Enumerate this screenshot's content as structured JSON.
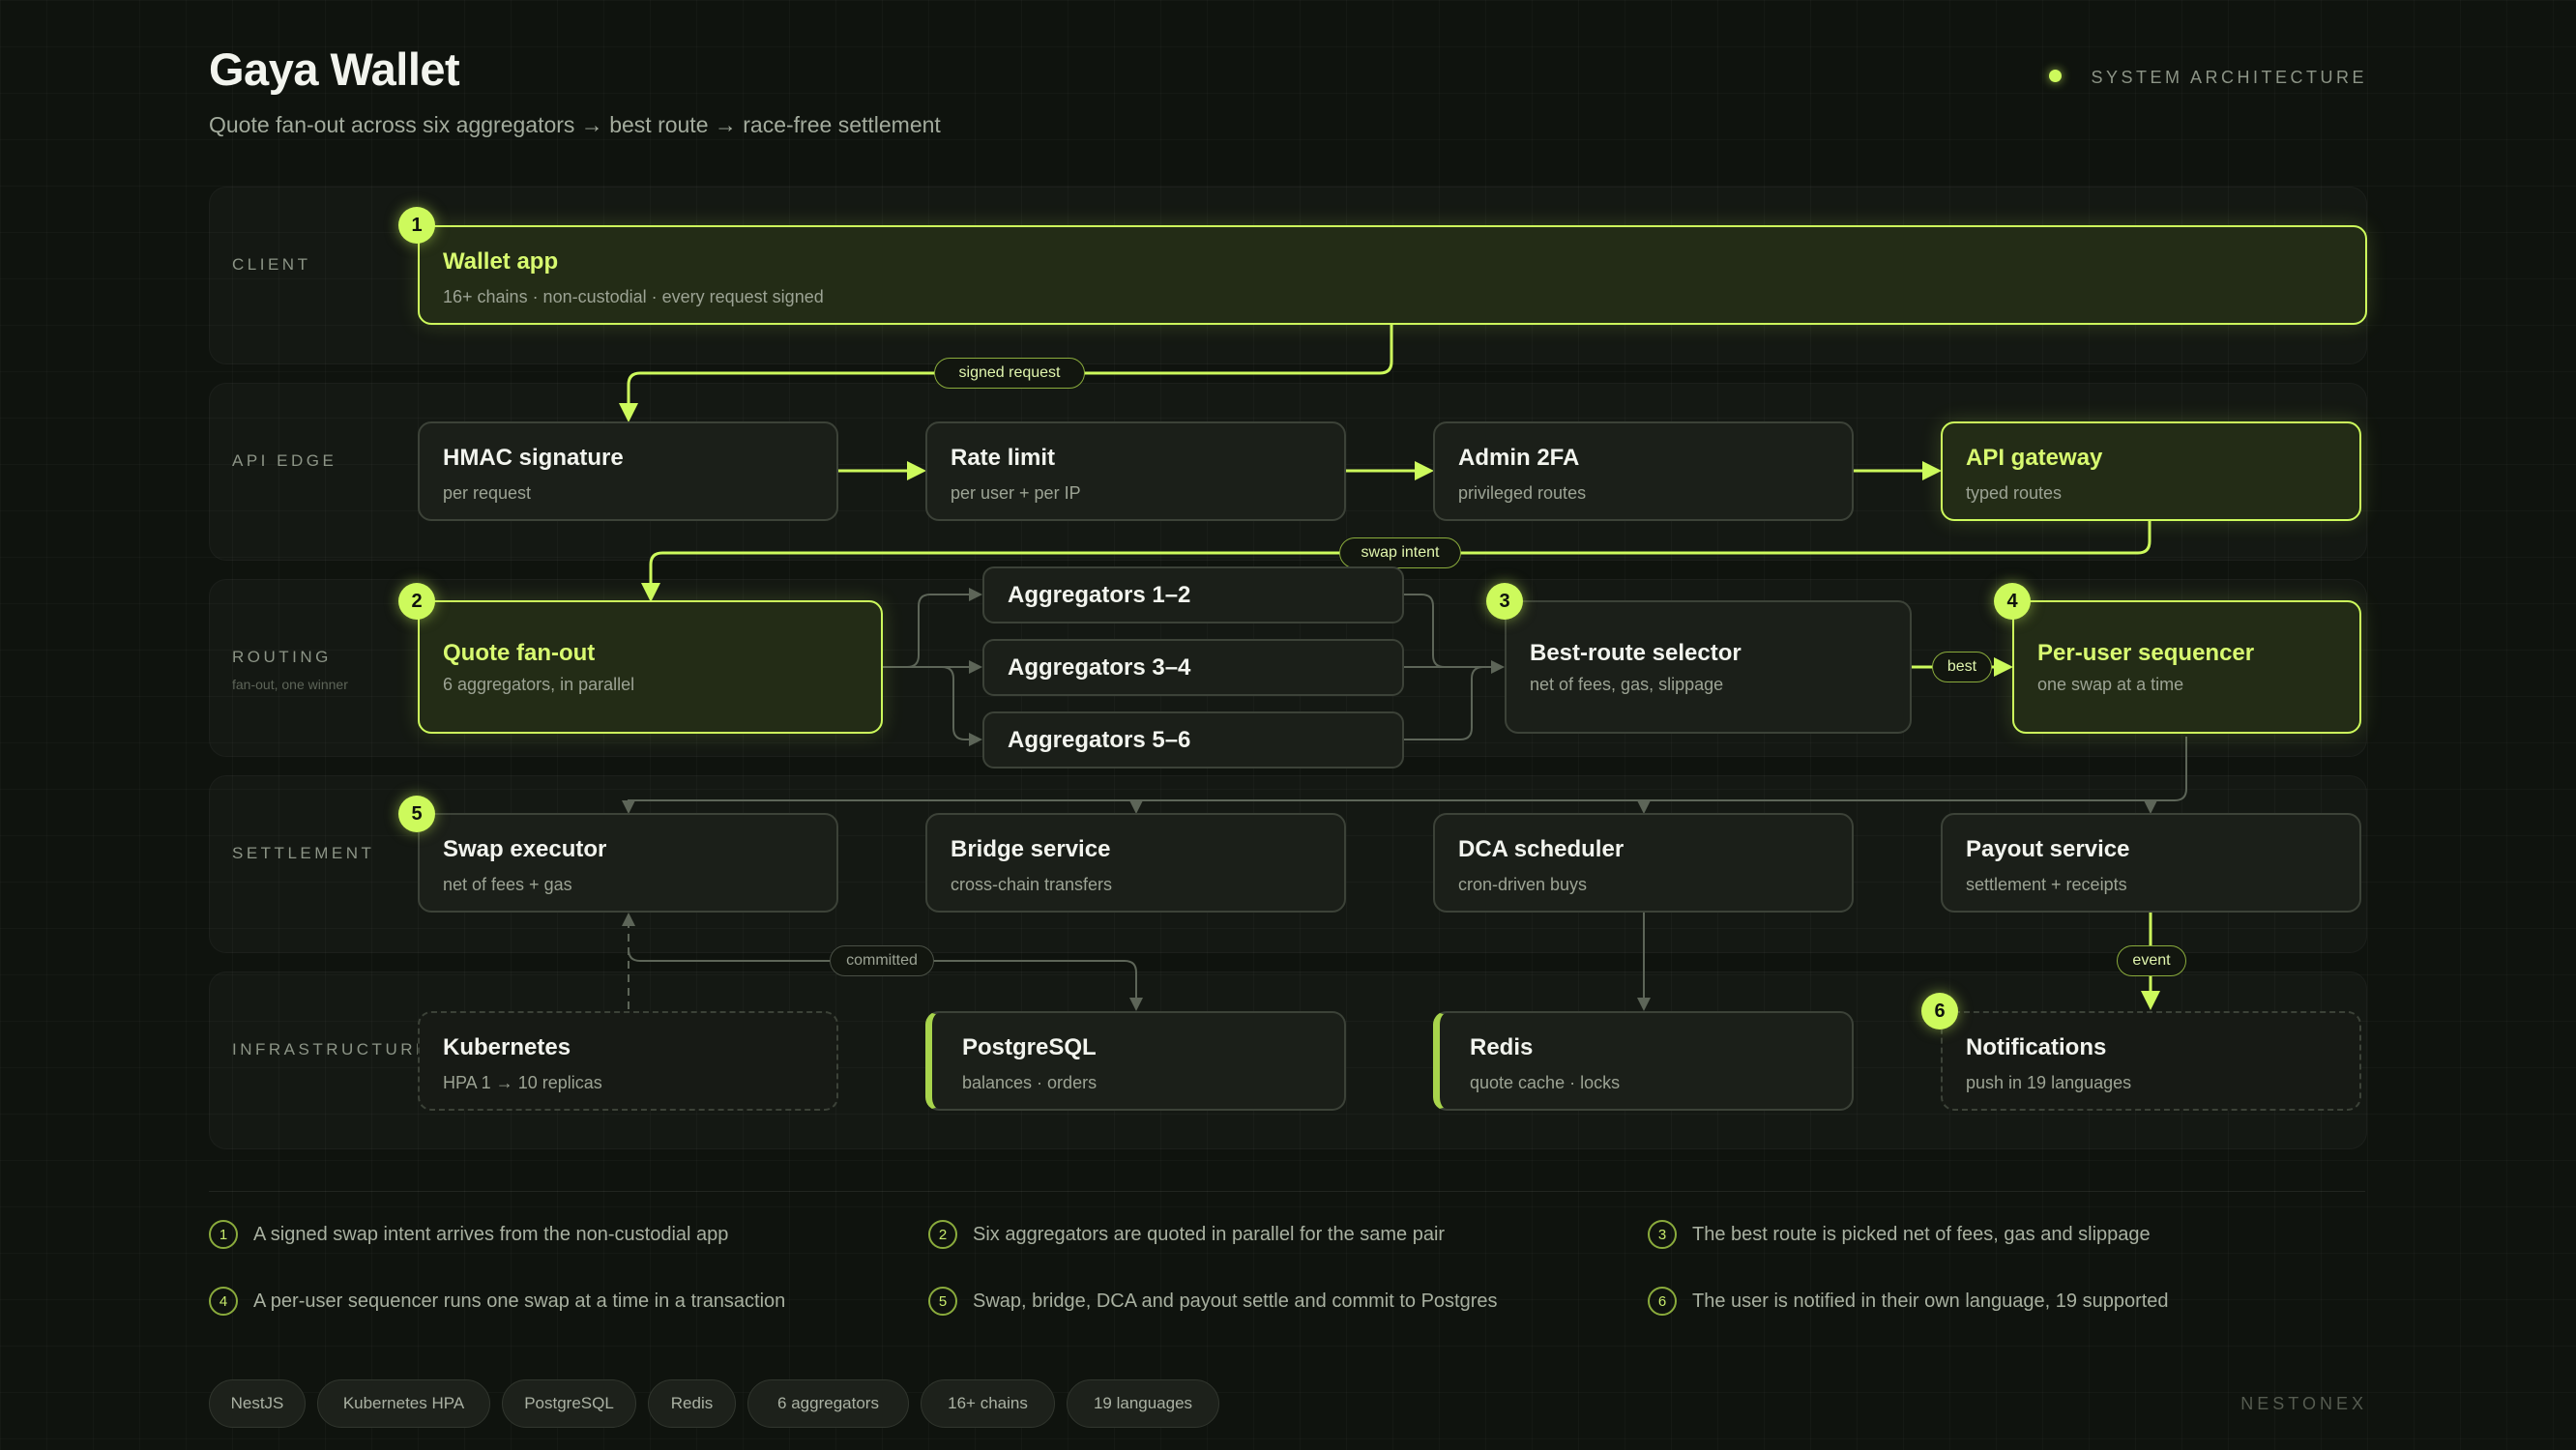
{
  "header": {
    "title": "Gaya Wallet",
    "subtitle": "Quote fan-out across six aggregators → best route → race-free settlement",
    "label": "SYSTEM ARCHITECTURE"
  },
  "lanes": {
    "client": "CLIENT",
    "api_edge": "API EDGE",
    "routing": "ROUTING",
    "routing_sub": "fan-out, one winner",
    "settlement": "SETTLEMENT",
    "infrastructure": "INFRASTRUCTURE"
  },
  "nodes": {
    "wallet": {
      "name": "Wallet app",
      "desc": "16+ chains · non-custodial · every request signed",
      "badge": "1"
    },
    "hmac": {
      "name": "HMAC signature",
      "desc": "per request"
    },
    "rate": {
      "name": "Rate limit",
      "desc": "per user + per IP"
    },
    "admin": {
      "name": "Admin 2FA",
      "desc": "privileged routes"
    },
    "gateway": {
      "name": "API gateway",
      "desc": "typed routes"
    },
    "fanout": {
      "name": "Quote fan-out",
      "desc": "6 aggregators, in parallel",
      "badge": "2"
    },
    "agg12": {
      "name": "Aggregators 1–2"
    },
    "agg34": {
      "name": "Aggregators 3–4"
    },
    "agg56": {
      "name": "Aggregators 5–6"
    },
    "best": {
      "name": "Best-route selector",
      "desc": "net of fees, gas, slippage",
      "badge": "3"
    },
    "sequencer": {
      "name": "Per-user sequencer",
      "desc": "one swap at a time",
      "badge": "4"
    },
    "swap": {
      "name": "Swap executor",
      "desc": "net of fees + gas",
      "badge": "5"
    },
    "bridge": {
      "name": "Bridge service",
      "desc": "cross-chain transfers"
    },
    "dca": {
      "name": "DCA scheduler",
      "desc": "cron-driven buys"
    },
    "payout": {
      "name": "Payout service",
      "desc": "settlement + receipts"
    },
    "k8s": {
      "name": "Kubernetes",
      "desc": "HPA 1 → 10 replicas"
    },
    "postgres": {
      "name": "PostgreSQL",
      "desc": "balances · orders"
    },
    "redis": {
      "name": "Redis",
      "desc": "quote cache · locks"
    },
    "notify": {
      "name": "Notifications",
      "desc": "push in 19 languages",
      "badge": "6"
    }
  },
  "edge_labels": {
    "signed_request": "signed request",
    "swap_intent": "swap intent",
    "best": "best",
    "committed": "committed",
    "event": "event"
  },
  "steps": [
    {
      "num": "1",
      "text": "A signed swap intent arrives from the non-custodial app"
    },
    {
      "num": "2",
      "text": "Six aggregators are quoted in parallel for the same pair"
    },
    {
      "num": "3",
      "text": "The best route is picked net of fees, gas and slippage"
    },
    {
      "num": "4",
      "text": "A per-user sequencer runs one swap at a time in a transaction"
    },
    {
      "num": "5",
      "text": "Swap, bridge, DCA and payout settle and commit to Postgres"
    },
    {
      "num": "6",
      "text": "The user is notified in their own language, 19 supported"
    }
  ],
  "chips": [
    "NestJS",
    "Kubernetes HPA",
    "PostgreSQL",
    "Redis",
    "6 aggregators",
    "16+ chains",
    "19 languages"
  ],
  "brand": "NESTONEX",
  "colors": {
    "accent": "#cdfa5c",
    "background": "#0f130e",
    "card": "#1b1f19",
    "muted": "#8c9486"
  }
}
